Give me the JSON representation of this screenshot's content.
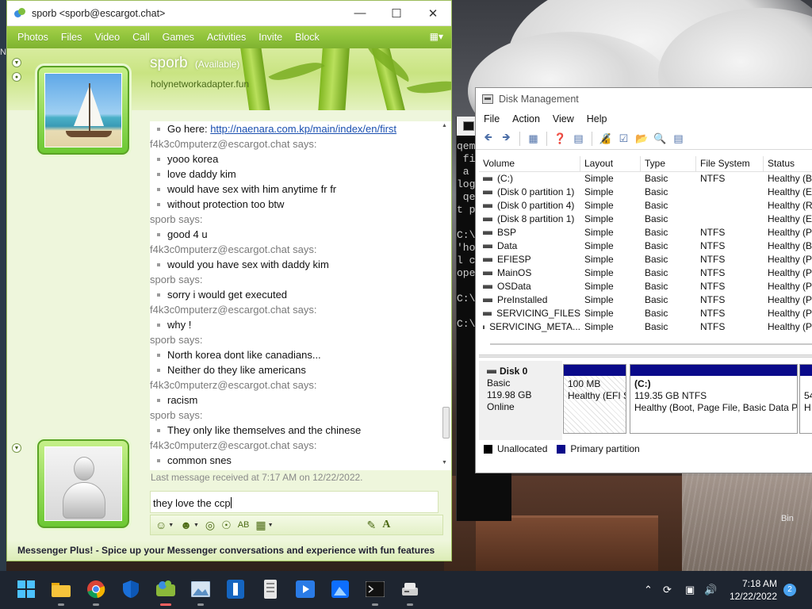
{
  "desktop": {
    "recycle_bin_fragment": "Bin",
    "left_glyph": "N"
  },
  "messenger": {
    "window_title": "sporb <sporb@escargot.chat>",
    "menu": [
      "Photos",
      "Files",
      "Video",
      "Call",
      "Games",
      "Activities",
      "Invite",
      "Block"
    ],
    "contact": {
      "name": "sporb",
      "status": "(Available)",
      "personal_message": "holynetworkadapter.fun"
    },
    "conversation": [
      {
        "kind": "msg",
        "text": "Go here: ",
        "link": "http://naenara.com.kp/main/index/en/first"
      },
      {
        "kind": "says",
        "text": "f4k3c0mputerz@escargot.chat says:"
      },
      {
        "kind": "msg",
        "text": "yooo korea"
      },
      {
        "kind": "msg",
        "text": " love daddy kim"
      },
      {
        "kind": "msg",
        "text": "would have sex with him anytime fr fr"
      },
      {
        "kind": "msg",
        "text": "without protection too btw"
      },
      {
        "kind": "says",
        "text": "sporb says:"
      },
      {
        "kind": "msg",
        "text": "good 4 u"
      },
      {
        "kind": "says",
        "text": "f4k3c0mputerz@escargot.chat says:"
      },
      {
        "kind": "msg",
        "text": "would you have sex with daddy kim"
      },
      {
        "kind": "says",
        "text": "sporb says:"
      },
      {
        "kind": "msg",
        "text": "sorry i would get executed"
      },
      {
        "kind": "says",
        "text": "f4k3c0mputerz@escargot.chat says:"
      },
      {
        "kind": "msg",
        "text": " why !"
      },
      {
        "kind": "says",
        "text": "sporb says:"
      },
      {
        "kind": "msg",
        "text": "North korea dont like canadians..."
      },
      {
        "kind": "msg",
        "text": "Neither do they like americans"
      },
      {
        "kind": "says",
        "text": "f4k3c0mputerz@escargot.chat says:"
      },
      {
        "kind": "msg",
        "text": "racism"
      },
      {
        "kind": "says",
        "text": "sporb says:"
      },
      {
        "kind": "msg",
        "text": "They only like themselves and the chinese"
      },
      {
        "kind": "says",
        "text": "f4k3c0mputerz@escargot.chat says:"
      },
      {
        "kind": "msg",
        "text": "common snes"
      }
    ],
    "last_message": "Last message received at 7:17 AM on 12/22/2022.",
    "input_text": "they love the ccp",
    "footer": "Messenger Plus! - Spice up your Messenger conversations and experience with fun features"
  },
  "console": {
    "lines": [
      "qem",
      " fi",
      " a ",
      "log",
      " qe",
      "t p",
      "",
      "C:\\",
      "'ho",
      "l c",
      "ope",
      "",
      "C:\\",
      "",
      "C:\\"
    ]
  },
  "disk_management": {
    "title": "Disk Management",
    "menu": [
      "File",
      "Action",
      "View",
      "Help"
    ],
    "columns": [
      "Volume",
      "Layout",
      "Type",
      "File System",
      "Status"
    ],
    "volumes": [
      {
        "volume": "(C:)",
        "layout": "Simple",
        "type": "Basic",
        "fs": "NTFS",
        "status": "Healthy (B"
      },
      {
        "volume": "(Disk 0 partition 1)",
        "layout": "Simple",
        "type": "Basic",
        "fs": "",
        "status": "Healthy (E"
      },
      {
        "volume": "(Disk 0 partition 4)",
        "layout": "Simple",
        "type": "Basic",
        "fs": "",
        "status": "Healthy (R"
      },
      {
        "volume": "(Disk 8 partition 1)",
        "layout": "Simple",
        "type": "Basic",
        "fs": "",
        "status": "Healthy (E"
      },
      {
        "volume": "BSP",
        "layout": "Simple",
        "type": "Basic",
        "fs": "NTFS",
        "status": "Healthy (P"
      },
      {
        "volume": "Data",
        "layout": "Simple",
        "type": "Basic",
        "fs": "NTFS",
        "status": "Healthy (B"
      },
      {
        "volume": "EFIESP",
        "layout": "Simple",
        "type": "Basic",
        "fs": "NTFS",
        "status": "Healthy (P"
      },
      {
        "volume": "MainOS",
        "layout": "Simple",
        "type": "Basic",
        "fs": "NTFS",
        "status": "Healthy (P"
      },
      {
        "volume": "OSData",
        "layout": "Simple",
        "type": "Basic",
        "fs": "NTFS",
        "status": "Healthy (P"
      },
      {
        "volume": "PreInstalled",
        "layout": "Simple",
        "type": "Basic",
        "fs": "NTFS",
        "status": "Healthy (P"
      },
      {
        "volume": "SERVICING_FILES",
        "layout": "Simple",
        "type": "Basic",
        "fs": "NTFS",
        "status": "Healthy (P"
      },
      {
        "volume": "SERVICING_META...",
        "layout": "Simple",
        "type": "Basic",
        "fs": "NTFS",
        "status": "Healthy (P"
      }
    ],
    "disk": {
      "name": "Disk 0",
      "type": "Basic",
      "size": "119.98 GB",
      "state": "Online"
    },
    "partitions": [
      {
        "label": "",
        "size": "100 MB",
        "status": "Healthy (EFI S"
      },
      {
        "label": "(C:)",
        "size": "119.35 GB NTFS",
        "status": "Healthy (Boot, Page File, Basic Data Pa"
      },
      {
        "label": "",
        "size": "54",
        "status": "H"
      }
    ],
    "legend": [
      "Unallocated",
      "Primary partition"
    ],
    "colors": {
      "unallocated": "#000000",
      "primary": "#0a0a8a"
    }
  },
  "taskbar": {
    "time": "7:18 AM",
    "date": "12/22/2022",
    "notification_count": "2"
  }
}
